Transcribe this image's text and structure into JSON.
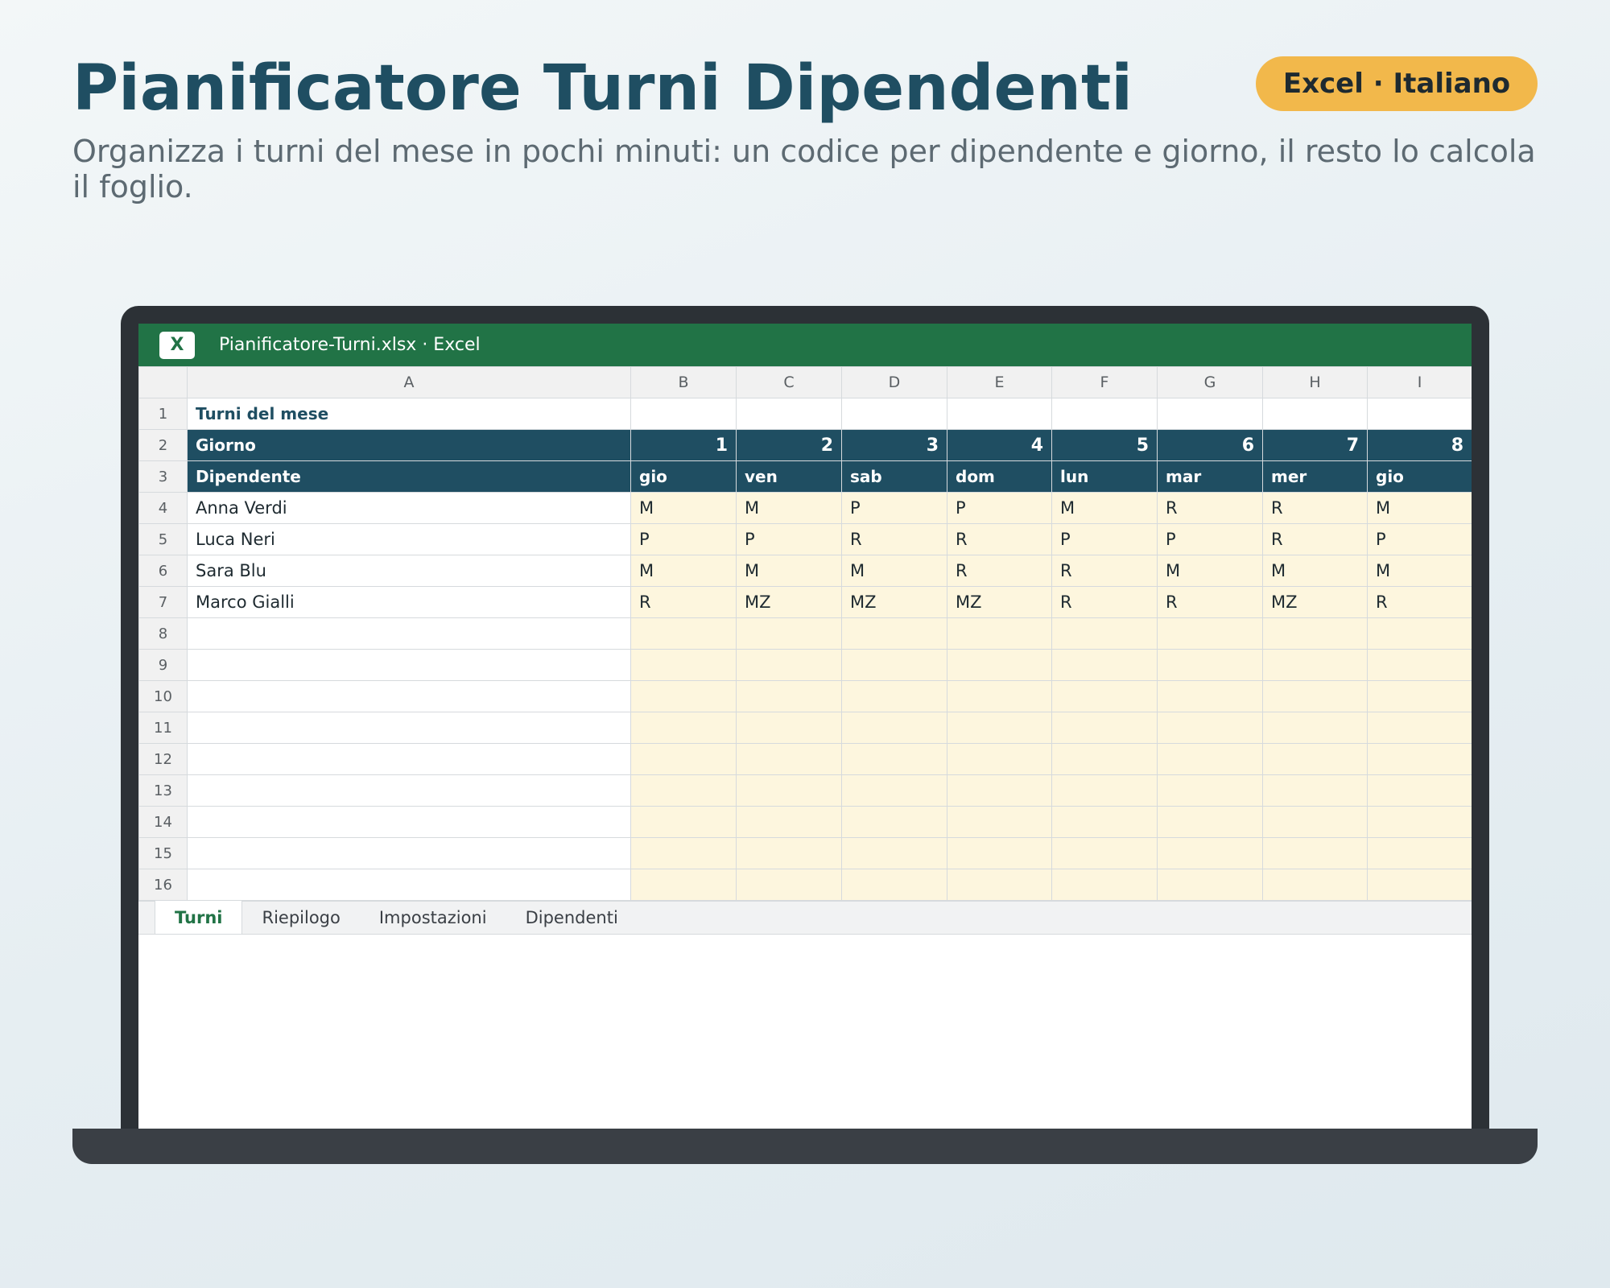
{
  "page": {
    "title": "Pianificatore Turni Dipendenti",
    "badge": "Excel · Italiano",
    "subtitle": "Organizza i turni del mese in pochi minuti: un codice per dipendente e giorno, il resto lo calcola il foglio."
  },
  "window": {
    "app_icon_label": "X",
    "title": "Pianificatore-Turni.xlsx · Excel"
  },
  "sheet": {
    "column_headers": [
      "A",
      "B",
      "C",
      "D",
      "E",
      "F",
      "G",
      "H",
      "I"
    ],
    "row_numbers": [
      "1",
      "2",
      "3",
      "4",
      "5",
      "6",
      "7",
      "8",
      "9",
      "10",
      "11",
      "12",
      "13",
      "14",
      "15",
      "16"
    ],
    "cell_title": "Turni del mese",
    "giorno_label": "Giorno",
    "dipendente_label": "Dipendente",
    "days": [
      "1",
      "2",
      "3",
      "4",
      "5",
      "6",
      "7",
      "8"
    ],
    "weekdays": [
      "gio",
      "ven",
      "sab",
      "dom",
      "lun",
      "mar",
      "mer",
      "gio"
    ],
    "employees": [
      {
        "name": "Anna Verdi",
        "shifts": [
          "M",
          "M",
          "P",
          "P",
          "M",
          "R",
          "R",
          "M"
        ]
      },
      {
        "name": "Luca Neri",
        "shifts": [
          "P",
          "P",
          "R",
          "R",
          "P",
          "P",
          "R",
          "P"
        ]
      },
      {
        "name": "Sara Blu",
        "shifts": [
          "M",
          "M",
          "M",
          "R",
          "R",
          "M",
          "M",
          "M"
        ]
      },
      {
        "name": "Marco Gialli",
        "shifts": [
          "R",
          "MZ",
          "MZ",
          "MZ",
          "R",
          "R",
          "MZ",
          "R"
        ]
      }
    ],
    "empty_row_count": 9
  },
  "tabs": [
    "Turni",
    "Riepilogo",
    "Impostazioni",
    "Dipendenti"
  ],
  "active_tab": "Turni",
  "colors": {
    "brand_dark": "#1f4e62",
    "excel_green": "#217346",
    "badge": "#f2b84b",
    "input_cell": "#fdf6de"
  }
}
